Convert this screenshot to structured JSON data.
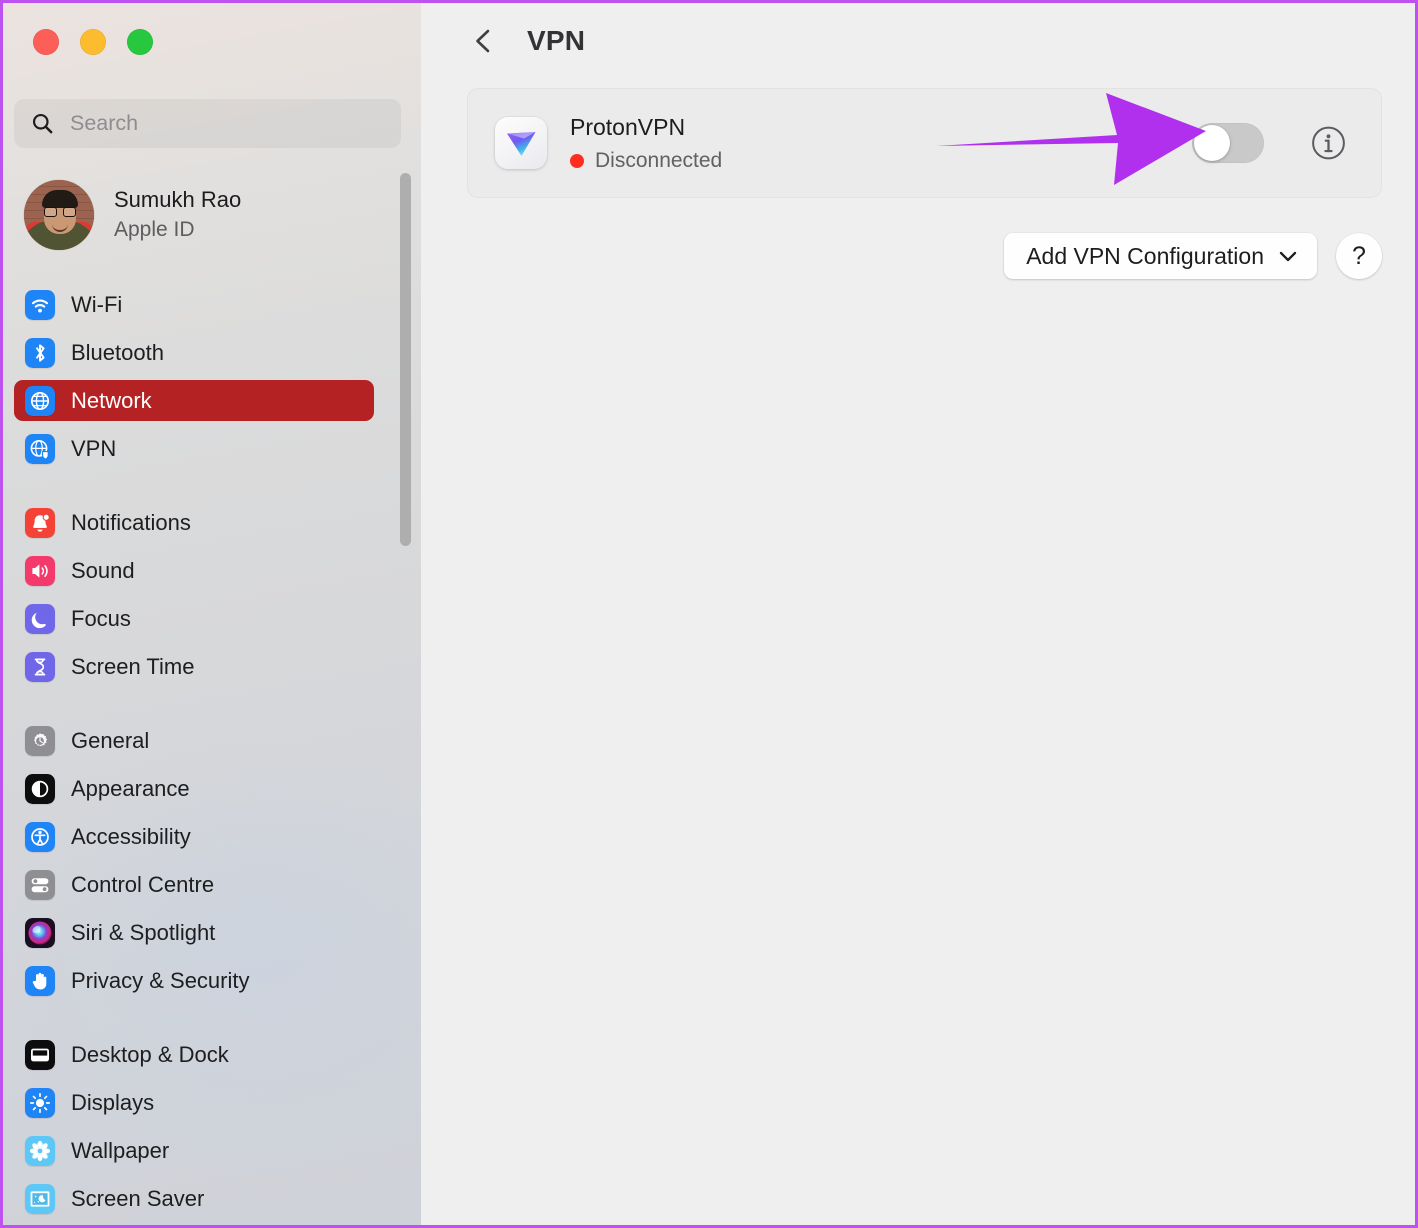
{
  "window": {
    "traffic_lights": [
      {
        "name": "close",
        "color": "#fc5f57"
      },
      {
        "name": "minimize",
        "color": "#fdbc2e"
      },
      {
        "name": "maximize",
        "color": "#27c840"
      }
    ]
  },
  "sidebar": {
    "search": {
      "placeholder": "Search",
      "value": "",
      "icon": "search-icon"
    },
    "account": {
      "name": "Sumukh Rao",
      "subtitle": "Apple ID",
      "avatar": "user-avatar"
    },
    "groups": [
      {
        "items": [
          {
            "label": "Wi-Fi",
            "icon": "wifi-icon",
            "selected": false
          },
          {
            "label": "Bluetooth",
            "icon": "bluetooth-icon",
            "selected": false
          },
          {
            "label": "Network",
            "icon": "globe-icon",
            "selected": true
          },
          {
            "label": "VPN",
            "icon": "vpn-globe-icon",
            "selected": false
          }
        ]
      },
      {
        "items": [
          {
            "label": "Notifications",
            "icon": "bell-icon",
            "selected": false
          },
          {
            "label": "Sound",
            "icon": "speaker-icon",
            "selected": false
          },
          {
            "label": "Focus",
            "icon": "moon-icon",
            "selected": false
          },
          {
            "label": "Screen Time",
            "icon": "hourglass-icon",
            "selected": false
          }
        ]
      },
      {
        "items": [
          {
            "label": "General",
            "icon": "gear-icon",
            "selected": false
          },
          {
            "label": "Appearance",
            "icon": "appearance-icon",
            "selected": false
          },
          {
            "label": "Accessibility",
            "icon": "accessibility-icon",
            "selected": false
          },
          {
            "label": "Control Centre",
            "icon": "control-centre-icon",
            "selected": false
          },
          {
            "label": "Siri & Spotlight",
            "icon": "siri-icon",
            "selected": false
          },
          {
            "label": "Privacy & Security",
            "icon": "hand-icon",
            "selected": false
          }
        ]
      },
      {
        "items": [
          {
            "label": "Desktop & Dock",
            "icon": "desktop-dock-icon",
            "selected": false
          },
          {
            "label": "Displays",
            "icon": "display-brightness-icon",
            "selected": false
          },
          {
            "label": "Wallpaper",
            "icon": "wallpaper-icon",
            "selected": false
          },
          {
            "label": "Screen Saver",
            "icon": "screen-saver-icon",
            "selected": false
          }
        ]
      }
    ],
    "selected_accent": "#b52223",
    "scrollbar_visible": true
  },
  "detail": {
    "back_icon": "chevron-left-icon",
    "title": "VPN",
    "vpn_entry": {
      "name": "ProtonVPN",
      "status": "Disconnected",
      "status_color": "#ff2d20",
      "icon": "protonvpn-icon",
      "toggle": {
        "name": "vpn-toggle",
        "state": "off"
      },
      "info_icon": "info-icon"
    },
    "buttons": {
      "add_vpn_label": "Add VPN Configuration",
      "add_vpn_chevron": "chevron-down-icon",
      "help_label": "?"
    }
  },
  "annotation": {
    "arrow": {
      "name": "purple-arrow-annotation",
      "color": "#b030ee",
      "points_to": "vpn-toggle"
    },
    "frame_border_color": "#bd52f0"
  }
}
